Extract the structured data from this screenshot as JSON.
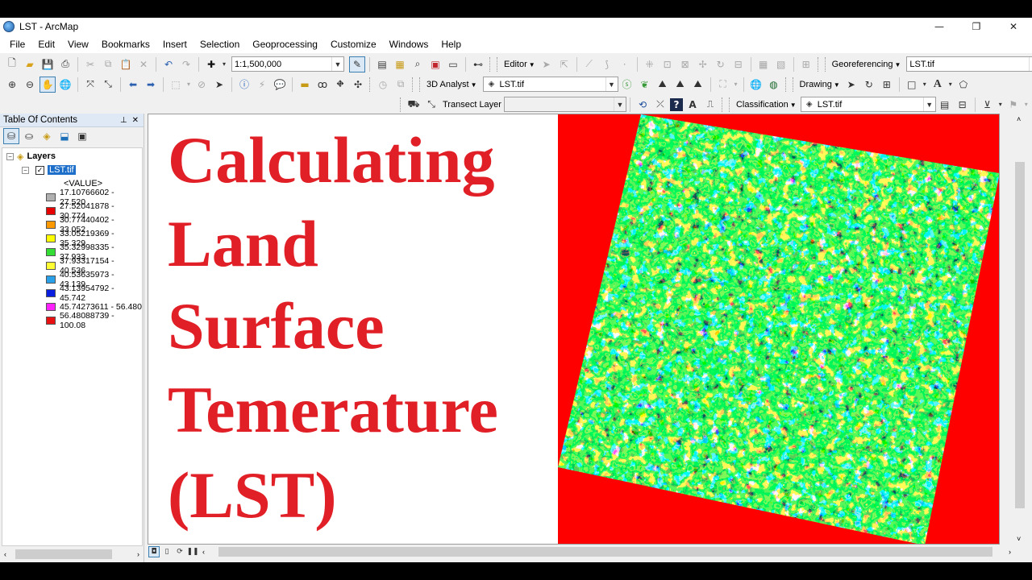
{
  "window": {
    "title": "LST - ArcMap",
    "minimize": "—",
    "restore": "❐",
    "close": "✕"
  },
  "menu": [
    "File",
    "Edit",
    "View",
    "Bookmarks",
    "Insert",
    "Selection",
    "Geoprocessing",
    "Customize",
    "Windows",
    "Help"
  ],
  "toolbar": {
    "scale_value": "1:1,500,000",
    "editor_label": "Editor",
    "georeferencing_label": "Georeferencing",
    "georef_layer": "LST.tif",
    "analyst_label": "3D Analyst",
    "analyst_layer": "LST.tif",
    "drawing_label": "Drawing",
    "font_icon_label": "A",
    "transect_label": "Transect Layer",
    "transect_value": "",
    "classification_label": "Classification",
    "classification_layer": "LST.tif"
  },
  "toc": {
    "title": "Table Of Contents",
    "pin": "⊥",
    "close": "✕",
    "root": "Layers",
    "layer": "LST.tif",
    "field": "<VALUE>",
    "legend": [
      {
        "label": "17.10766602 - 27.520",
        "color": "#b0b0b0"
      },
      {
        "label": "27.52041878 - 30.774",
        "color": "#e60000"
      },
      {
        "label": "30.77440402 - 33.052",
        "color": "#ff9900"
      },
      {
        "label": "33.05219369 - 35.329",
        "color": "#ffff00"
      },
      {
        "label": "35.32998335 - 37.933",
        "color": "#33dd33"
      },
      {
        "label": "37.93317154 - 40.536",
        "color": "#ffff33"
      },
      {
        "label": "40.53635973 - 43.139",
        "color": "#2aa0e8"
      },
      {
        "label": "43.13954792 - 45.742",
        "color": "#0a1ee0"
      },
      {
        "label": "45.74273611 - 56.480",
        "color": "#ff22ff"
      },
      {
        "label": "56.48088739 - 100.08",
        "color": "#e81010"
      }
    ]
  },
  "map": {
    "headline": [
      "Calculating",
      "Land",
      "Surface",
      "Temerature",
      "(LST)"
    ],
    "headline_color": "#e11f26",
    "raster_background": "#ff0000"
  }
}
